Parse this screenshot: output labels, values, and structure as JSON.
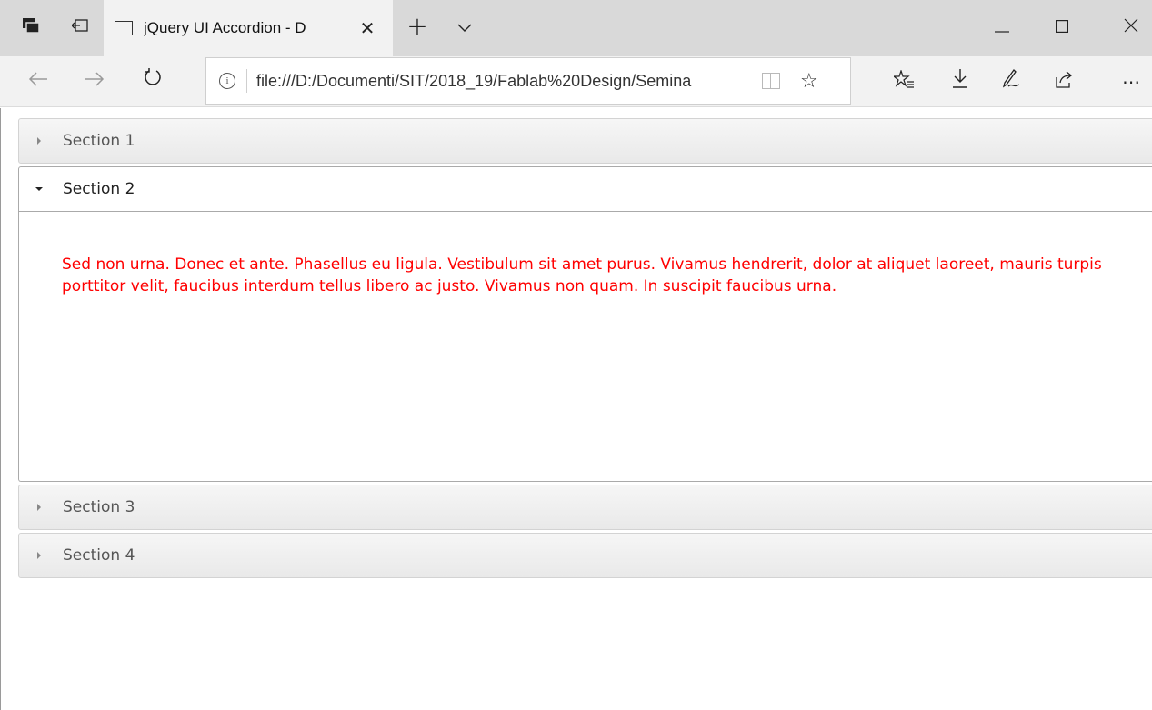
{
  "browser": {
    "tab": {
      "title": "jQuery UI Accordion - D"
    },
    "address": {
      "url": "file:///D:/Documenti/SIT/2018_19/Fablab%20Design/Semina"
    },
    "icons": {
      "tab_actions": "tab-actions-icon",
      "set_aside": "set-aside-tabs-icon",
      "page": "page-icon",
      "close_tab": "close-icon",
      "new_tab": "plus-icon",
      "tab_list": "chevron-down-icon",
      "minimize": "minimize-icon",
      "maximize": "maximize-icon",
      "close_window": "close-icon",
      "back": "back-arrow-icon",
      "forward": "forward-arrow-icon",
      "refresh": "refresh-icon",
      "info": "info-icon",
      "reading_view": "reading-view-icon",
      "favorite": "star-icon",
      "favorites_hub": "favorites-list-icon",
      "downloads": "download-icon",
      "notes": "pen-icon",
      "share": "share-icon",
      "more": "more-icon"
    }
  },
  "accordion": {
    "sections": [
      {
        "label": "Section 1",
        "expanded": false
      },
      {
        "label": "Section 2",
        "expanded": true,
        "content": "Sed non urna. Donec et ante. Phasellus eu ligula. Vestibulum sit amet purus. Vivamus hendrerit, dolor at aliquet laoreet, mauris turpis porttitor velit, faucibus interdum tellus libero ac justo. Vivamus non quam. In suscipit faucibus urna."
      },
      {
        "label": "Section 3",
        "expanded": false
      },
      {
        "label": "Section 4",
        "expanded": false
      }
    ],
    "colors": {
      "content_text": "#ff0000",
      "header_bg": "#ededed",
      "active_header_bg": "#ffffff"
    }
  }
}
